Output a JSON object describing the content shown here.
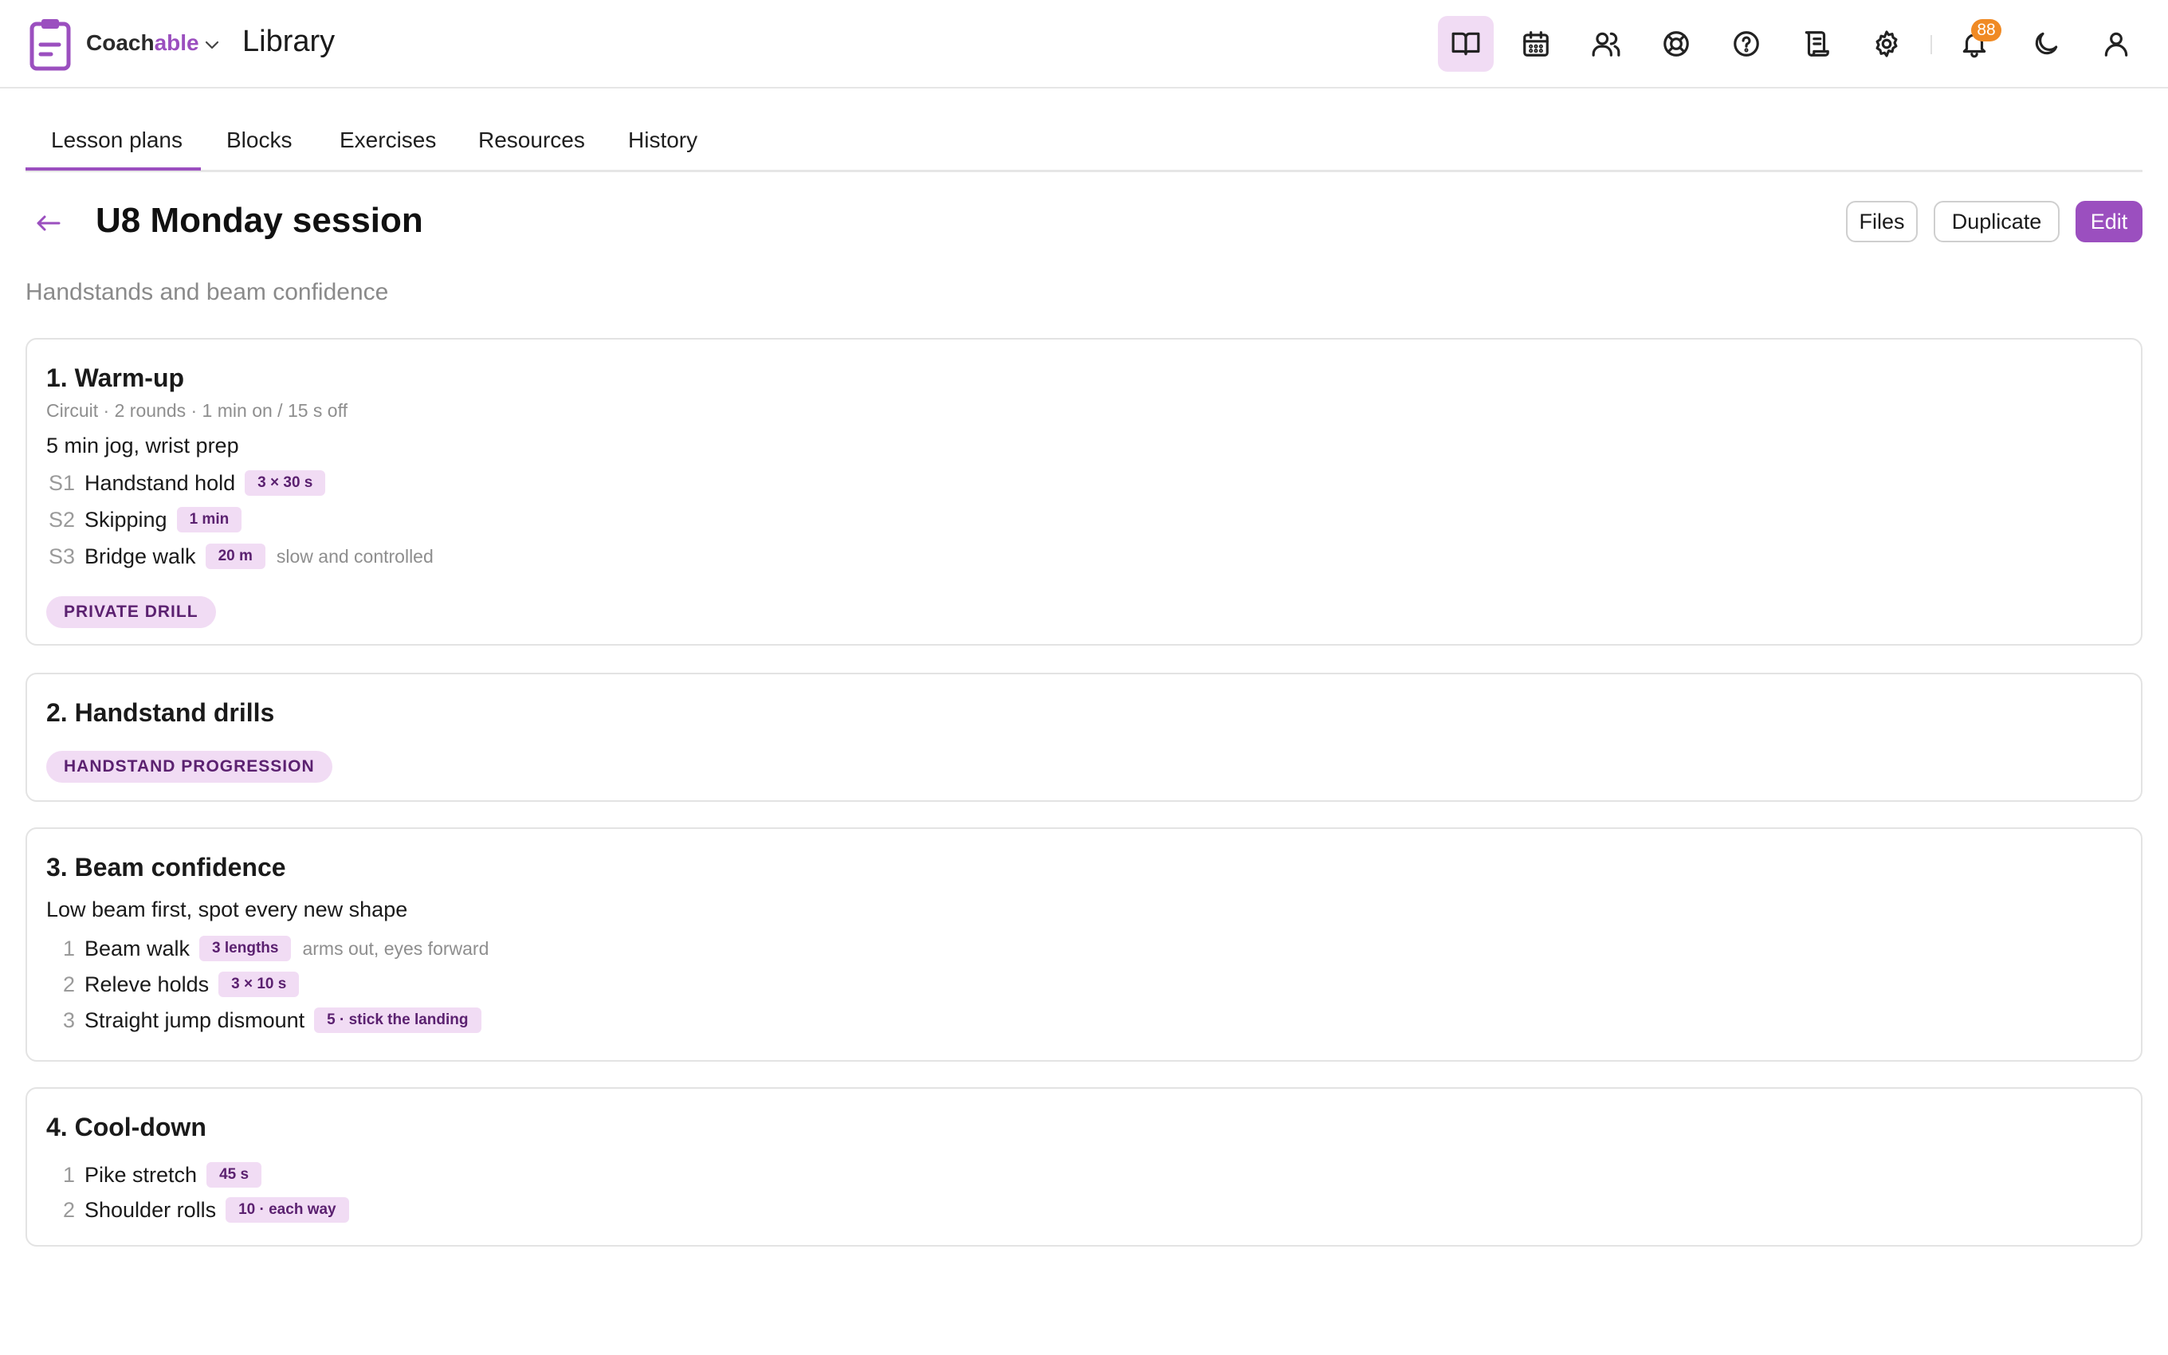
{
  "header": {
    "brand_main": "Coach",
    "brand_accent": "able",
    "page_name": "Library",
    "notification_count": "88",
    "icons": [
      "library-icon",
      "calendar-icon",
      "users-icon",
      "help-lifebuoy-icon",
      "question-icon",
      "scroll-icon",
      "gear-icon",
      "bell-icon",
      "moon-icon",
      "user-icon"
    ]
  },
  "tabs": [
    "Lesson plans",
    "Blocks",
    "Exercises",
    "Resources",
    "History"
  ],
  "plan": {
    "title": "U8 Monday session",
    "subtitle": "Handstands and beam confidence",
    "actions": {
      "files": "Files",
      "duplicate": "Duplicate",
      "edit": "Edit"
    }
  },
  "blocks": [
    {
      "title": "1. Warm-up",
      "meta": "Circuit · 2 rounds · 1 min on / 15 s off",
      "description": "5 min jog, wrist prep",
      "items": [
        {
          "num": "S1",
          "name": "Handstand hold",
          "dose": "3 × 30 s",
          "note": ""
        },
        {
          "num": "S2",
          "name": "Skipping",
          "dose": "1 min",
          "note": ""
        },
        {
          "num": "S3",
          "name": "Bridge walk",
          "dose": "20 m",
          "note": "slow and controlled"
        }
      ],
      "tag": "PRIVATE DRILL"
    },
    {
      "title": "2. Handstand drills",
      "tag": "HANDSTAND PROGRESSION"
    },
    {
      "title": "3. Beam confidence",
      "description": "Low beam first, spot every new shape",
      "items": [
        {
          "num": "1",
          "name": "Beam walk",
          "dose": "3 lengths",
          "note": "arms out, eyes forward"
        },
        {
          "num": "2",
          "name": "Releve holds",
          "dose": "3 × 10 s",
          "note": ""
        },
        {
          "num": "3",
          "name": "Straight jump dismount",
          "dose": "5 · stick the landing",
          "note": ""
        }
      ]
    },
    {
      "title": "4. Cool-down",
      "items": [
        {
          "num": "1",
          "name": "Pike stretch",
          "dose": "45 s",
          "note": ""
        },
        {
          "num": "2",
          "name": "Shoulder rolls",
          "dose": "10 · each way",
          "note": ""
        }
      ]
    }
  ],
  "colors": {
    "accent": "#9b4fbf",
    "accent_light": "#f1dcf4",
    "badge": "#f08a24"
  }
}
